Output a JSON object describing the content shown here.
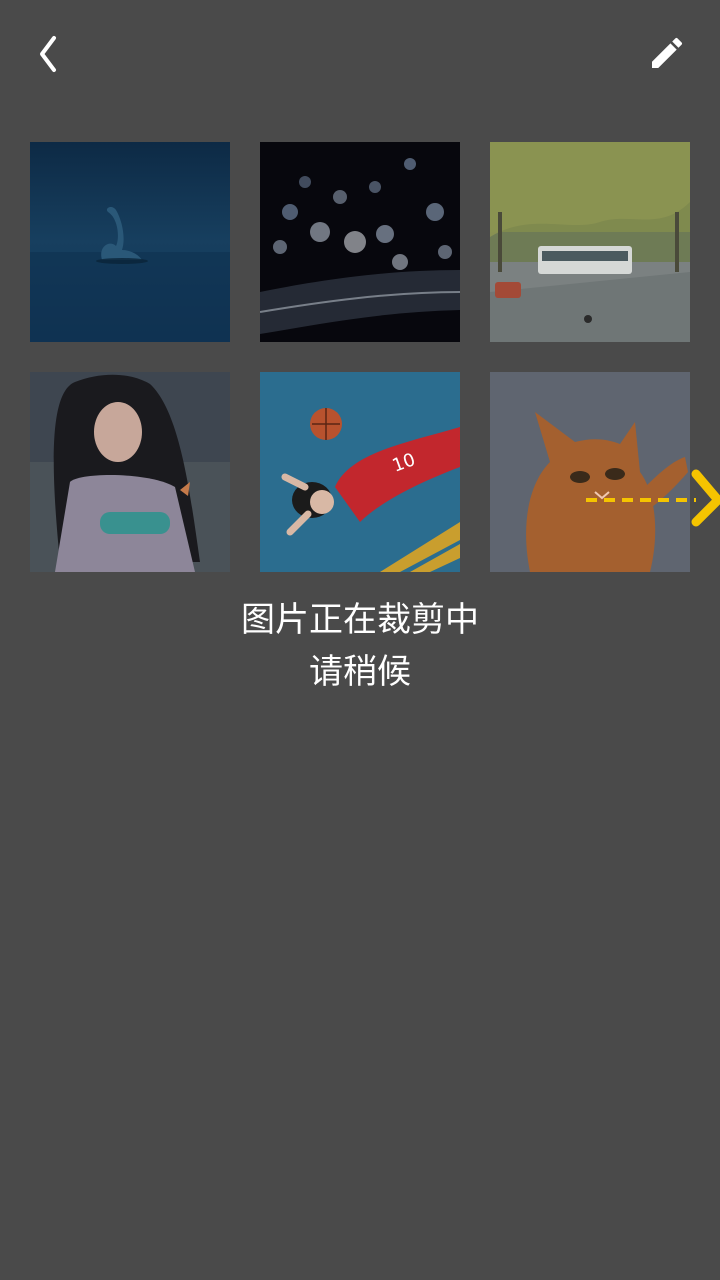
{
  "header": {
    "back_icon": "chevron-left-icon",
    "edit_icon": "pencil-icon"
  },
  "gallery": {
    "photos": [
      {
        "subject": "swan"
      },
      {
        "subject": "bokeh-lights"
      },
      {
        "subject": "street-bus"
      },
      {
        "subject": "girl-portrait"
      },
      {
        "subject": "basketball-player"
      },
      {
        "subject": "orange-cat"
      }
    ]
  },
  "status": {
    "line1": "图片正在裁剪中",
    "line2": "请稍候"
  },
  "colors": {
    "background": "#4a4a4a",
    "accent": "#f5c400",
    "text": "#ffffff"
  },
  "indicator": {
    "icon": "crop-arrow-icon"
  }
}
